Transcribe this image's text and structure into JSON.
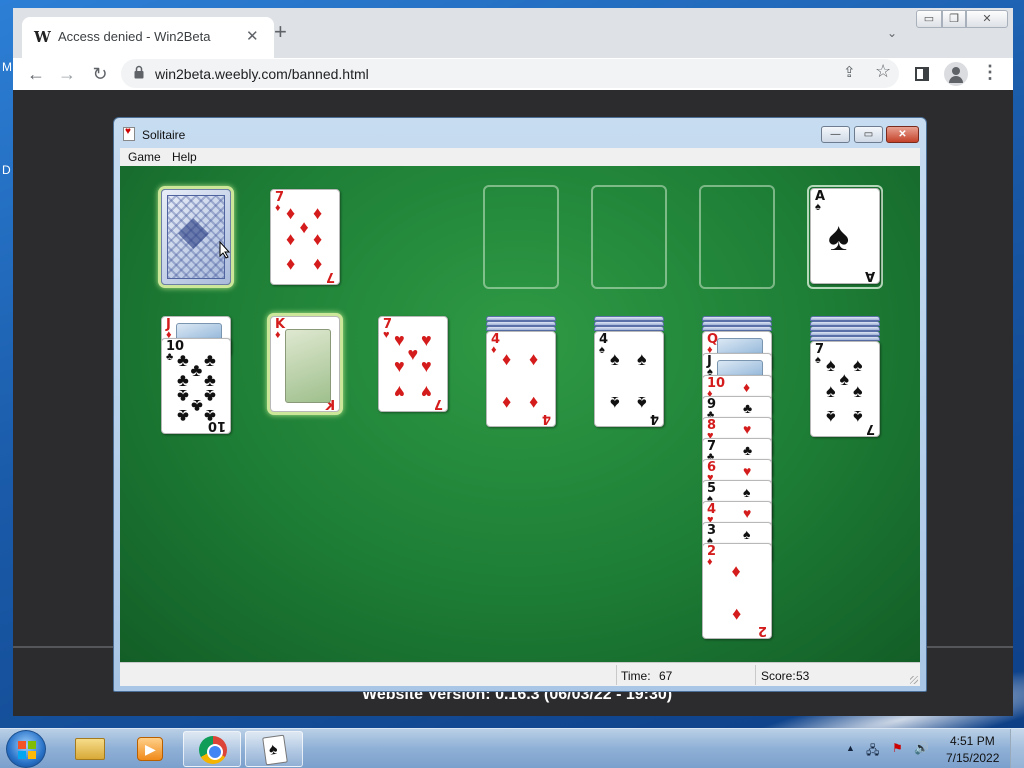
{
  "desktop": {
    "left_letters": [
      "M",
      "D"
    ]
  },
  "browser": {
    "tab_title": "Access denied - Win2Beta",
    "favicon_text": "W",
    "tab_close": "✕",
    "new_tab": "+",
    "tab_search": "⌄",
    "url": "win2beta.weebly.com/banned.html",
    "icons": {
      "back": "←",
      "forward": "→",
      "reload": "↻",
      "share": "⇪",
      "bookmark": "☆",
      "menu": "⋮",
      "win_minimize": "▭",
      "win_restore": "❐",
      "win_close": "✕"
    },
    "page": {
      "website_version": "Website Version: 0.16.3 (06/03/22 - 19:30)"
    }
  },
  "solitaire": {
    "title": "Solitaire",
    "menu": [
      "Game",
      "Help"
    ],
    "time_label": "Time:",
    "time_value": "67",
    "score_label": "Score:",
    "score_value": "53",
    "buttons": {
      "minimize": "—",
      "maximize": "▭",
      "close": "✕"
    },
    "stock": {
      "face_down": true,
      "selected": true
    },
    "waste": {
      "rank": "7",
      "suit": "♦",
      "color": "red"
    },
    "foundations": [
      {
        "empty": true
      },
      {
        "empty": true
      },
      {
        "empty": true
      },
      {
        "rank": "A",
        "suit": "♠",
        "color": "black"
      }
    ],
    "tableau": [
      {
        "cards": [
          {
            "rank": "J",
            "suit": "♦",
            "color": "red"
          },
          {
            "rank": "10",
            "suit": "♣",
            "color": "black"
          }
        ]
      },
      {
        "cards": [
          {
            "rank": "K",
            "suit": "♦",
            "color": "red",
            "selected": true
          }
        ]
      },
      {
        "cards": [
          {
            "rank": "7",
            "suit": "♥",
            "color": "red"
          }
        ]
      },
      {
        "hidden": 3,
        "cards": [
          {
            "rank": "4",
            "suit": "♦",
            "color": "red"
          }
        ]
      },
      {
        "hidden": 3,
        "cards": [
          {
            "rank": "4",
            "suit": "♠",
            "color": "black"
          }
        ]
      },
      {
        "hidden": 3,
        "cards": [
          {
            "rank": "Q",
            "suit": "♦",
            "color": "red"
          },
          {
            "rank": "J",
            "suit": "♠",
            "color": "black"
          },
          {
            "rank": "10",
            "suit": "♦",
            "color": "red"
          },
          {
            "rank": "9",
            "suit": "♣",
            "color": "black"
          },
          {
            "rank": "8",
            "suit": "♥",
            "color": "red"
          },
          {
            "rank": "7",
            "suit": "♣",
            "color": "black"
          },
          {
            "rank": "6",
            "suit": "♥",
            "color": "red"
          },
          {
            "rank": "5",
            "suit": "♠",
            "color": "black"
          },
          {
            "rank": "4",
            "suit": "♥",
            "color": "red"
          },
          {
            "rank": "3",
            "suit": "♠",
            "color": "black"
          },
          {
            "rank": "2",
            "suit": "♦",
            "color": "red"
          }
        ]
      },
      {
        "hidden": 5,
        "cards": [
          {
            "rank": "7",
            "suit": "♠",
            "color": "black"
          }
        ]
      }
    ]
  },
  "taskbar": {
    "apps": [
      "file-explorer-icon",
      "media-player-icon",
      "chrome-icon",
      "solitaire-icon"
    ],
    "tray": {
      "arrow": "▲",
      "network": "🖧",
      "flag": "⚑",
      "volume": "🔊"
    },
    "clock_time": "4:51 PM",
    "clock_date": "7/15/2022"
  }
}
